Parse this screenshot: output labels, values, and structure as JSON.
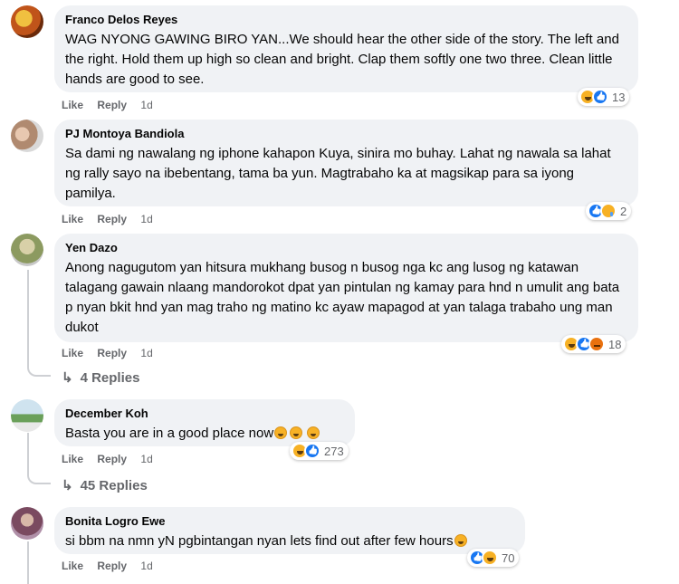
{
  "action_labels": {
    "like": "Like",
    "reply": "Reply"
  },
  "comments": [
    {
      "author": "Franco Delos Reyes",
      "text": "WAG NYONG GAWING BIRO YAN...We should hear the other side of the story. The left and the right. Hold them up high so clean and bright. Clap them softly one two three. Clean little hands are good to see.",
      "time": "1d",
      "reactions": [
        "haha",
        "like"
      ],
      "reaction_count": "13"
    },
    {
      "author": "PJ Montoya Bandiola",
      "text": "Sa dami ng nawalang ng iphone kahapon Kuya, sinira mo buhay. Lahat ng nawala sa lahat ng rally sayo na ibebentang, tama ba yun. Magtrabaho ka at magsikap para sa iyong pamilya.",
      "time": "1d",
      "reactions": [
        "like",
        "sad"
      ],
      "reaction_count": "2"
    },
    {
      "author": "Yen Dazo",
      "text": "Anong nagugutom yan hitsura mukhang busog n busog nga kc ang lusog ng katawan talagang gawain nlaang mandorokot dpat yan pintulan ng kamay para hnd n umulit ang bata p nyan bkit hnd yan mag traho ng matino kc ayaw mapagod at yan talaga trabaho ung man dukot",
      "time": "1d",
      "reactions": [
        "haha",
        "like",
        "angry"
      ],
      "reaction_count": "18",
      "replies_label": "4 Replies"
    },
    {
      "author": "December Koh",
      "text": "Basta you are in a good place now",
      "time": "1d",
      "reactions": [
        "haha",
        "like"
      ],
      "reaction_count": "273",
      "replies_label": "45 Replies"
    },
    {
      "author": "Bonita Logro Ewe",
      "text": "si bbm na nmn yN pgbintangan nyan lets find out after few hours",
      "time": "1d",
      "reactions": [
        "like",
        "haha"
      ],
      "reaction_count": "70"
    }
  ],
  "colors": {
    "bubble": "#f0f2f5",
    "meta_text": "#65676b",
    "like_blue": "#1877f2",
    "emoji_yellow": "#f7b125",
    "angry_orange": "#e9710f"
  }
}
